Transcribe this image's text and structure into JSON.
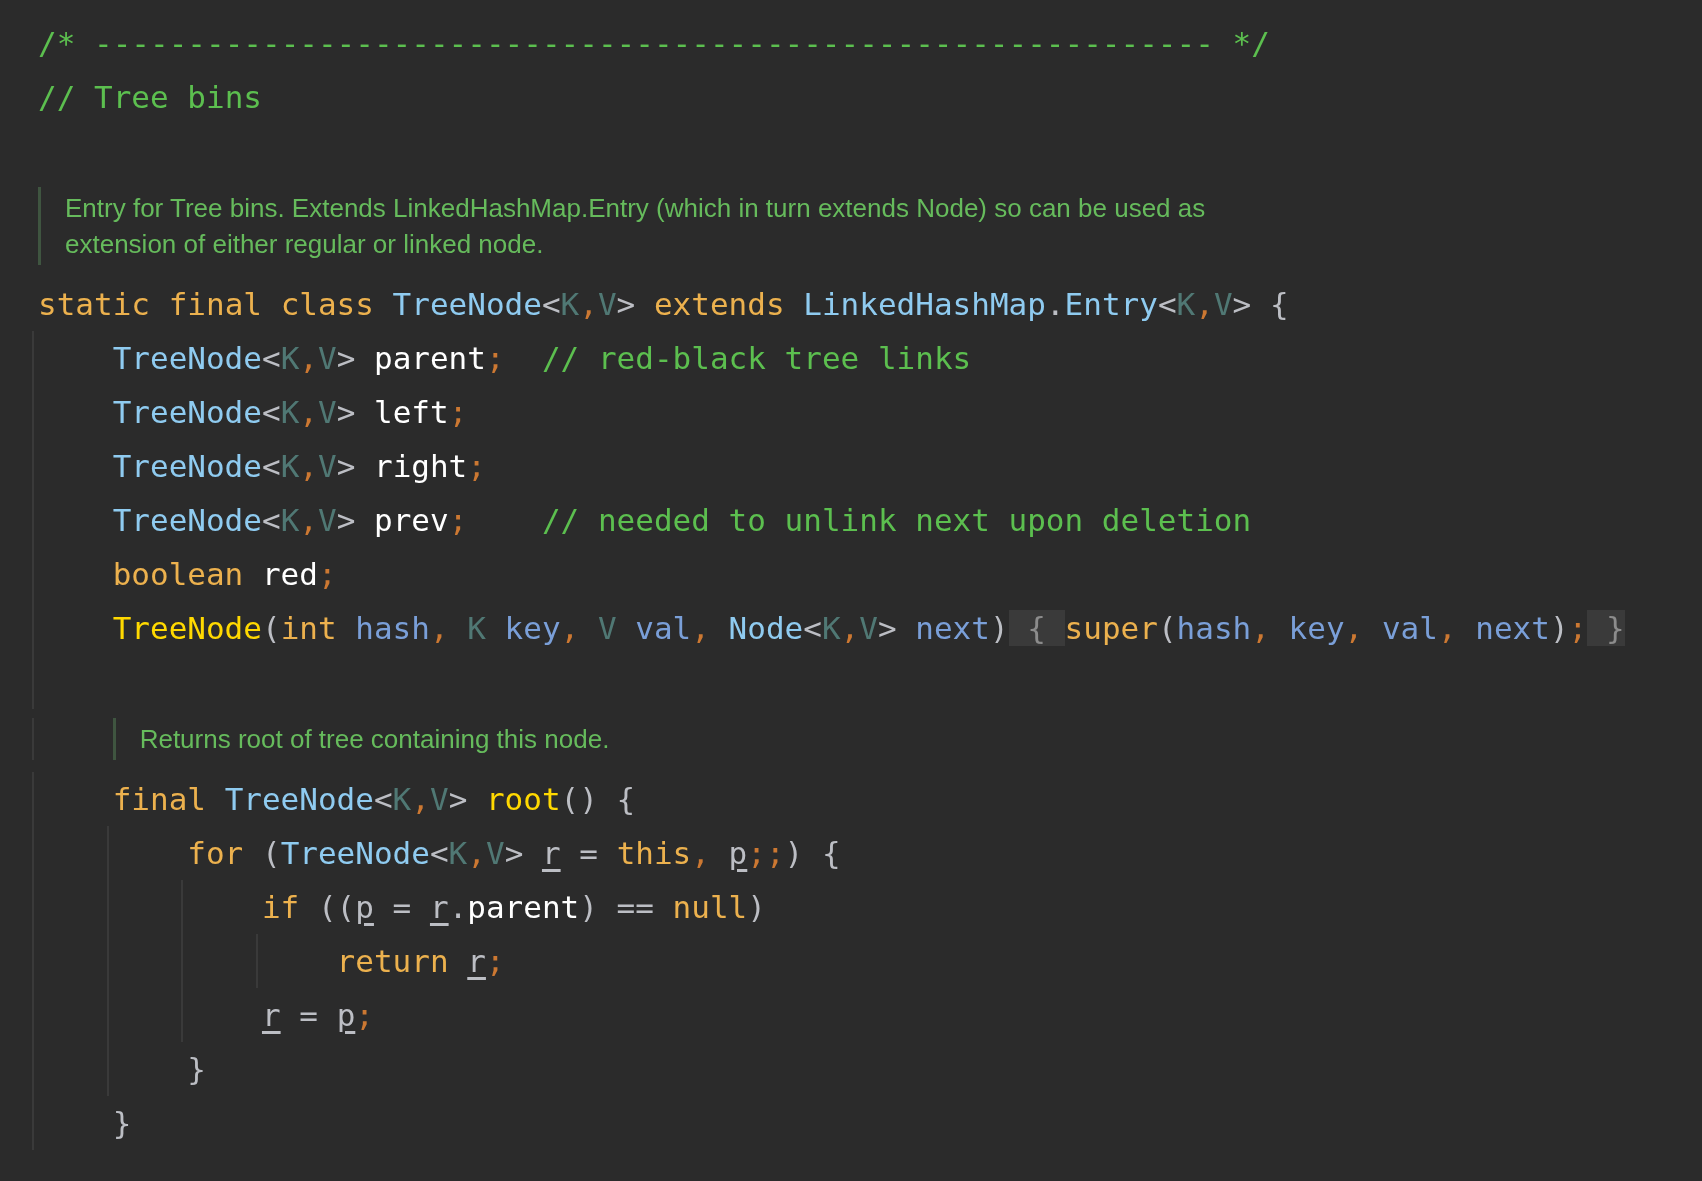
{
  "lines": [
    {
      "kind": "code",
      "tokens": [
        {
          "kind": "comment",
          "text": "/* ------------------------------------------------------------ */"
        }
      ]
    },
    {
      "kind": "code",
      "tokens": [
        {
          "kind": "comment",
          "text": "// Tree bins"
        }
      ]
    },
    {
      "kind": "blank"
    },
    {
      "kind": "doc",
      "text": "Entry for Tree bins. Extends LinkedHashMap.Entry (which in turn extends Node) so can be used as extension of either regular or linked node."
    },
    {
      "kind": "code",
      "tokens": [
        {
          "kind": "keyword",
          "text": "static final class "
        },
        {
          "kind": "type",
          "text": "TreeNode"
        },
        {
          "kind": "op",
          "text": "<"
        },
        {
          "kind": "typeparam",
          "text": "K"
        },
        {
          "kind": "punct",
          "text": ","
        },
        {
          "kind": "typeparam",
          "text": "V"
        },
        {
          "kind": "op",
          "text": "> "
        },
        {
          "kind": "keyword",
          "text": "extends "
        },
        {
          "kind": "type",
          "text": "LinkedHashMap"
        },
        {
          "kind": "op",
          "text": "."
        },
        {
          "kind": "type",
          "text": "Entry"
        },
        {
          "kind": "op",
          "text": "<"
        },
        {
          "kind": "typeparam",
          "text": "K"
        },
        {
          "kind": "punct",
          "text": ","
        },
        {
          "kind": "typeparam",
          "text": "V"
        },
        {
          "kind": "op",
          "text": "> {"
        }
      ],
      "children": [
        {
          "kind": "code",
          "tokens": [
            {
              "kind": "type",
              "text": "TreeNode"
            },
            {
              "kind": "op",
              "text": "<"
            },
            {
              "kind": "typeparam",
              "text": "K"
            },
            {
              "kind": "punct",
              "text": ","
            },
            {
              "kind": "typeparam",
              "text": "V"
            },
            {
              "kind": "op",
              "text": "> "
            },
            {
              "kind": "field",
              "text": "parent"
            },
            {
              "kind": "punct",
              "text": ";  "
            },
            {
              "kind": "comment",
              "text": "// red-black tree links"
            }
          ]
        },
        {
          "kind": "code",
          "tokens": [
            {
              "kind": "type",
              "text": "TreeNode"
            },
            {
              "kind": "op",
              "text": "<"
            },
            {
              "kind": "typeparam",
              "text": "K"
            },
            {
              "kind": "punct",
              "text": ","
            },
            {
              "kind": "typeparam",
              "text": "V"
            },
            {
              "kind": "op",
              "text": "> "
            },
            {
              "kind": "field",
              "text": "left"
            },
            {
              "kind": "punct",
              "text": ";"
            }
          ]
        },
        {
          "kind": "code",
          "tokens": [
            {
              "kind": "type",
              "text": "TreeNode"
            },
            {
              "kind": "op",
              "text": "<"
            },
            {
              "kind": "typeparam",
              "text": "K"
            },
            {
              "kind": "punct",
              "text": ","
            },
            {
              "kind": "typeparam",
              "text": "V"
            },
            {
              "kind": "op",
              "text": "> "
            },
            {
              "kind": "field",
              "text": "right"
            },
            {
              "kind": "punct",
              "text": ";"
            }
          ]
        },
        {
          "kind": "code",
          "tokens": [
            {
              "kind": "type",
              "text": "TreeNode"
            },
            {
              "kind": "op",
              "text": "<"
            },
            {
              "kind": "typeparam",
              "text": "K"
            },
            {
              "kind": "punct",
              "text": ","
            },
            {
              "kind": "typeparam",
              "text": "V"
            },
            {
              "kind": "op",
              "text": "> "
            },
            {
              "kind": "field",
              "text": "prev"
            },
            {
              "kind": "punct",
              "text": ";    "
            },
            {
              "kind": "comment",
              "text": "// needed to unlink next upon deletion"
            }
          ]
        },
        {
          "kind": "code",
          "tokens": [
            {
              "kind": "keyword",
              "text": "boolean "
            },
            {
              "kind": "field",
              "text": "red"
            },
            {
              "kind": "punct",
              "text": ";"
            }
          ]
        },
        {
          "kind": "code",
          "tokens": [
            {
              "kind": "method",
              "text": "TreeNode"
            },
            {
              "kind": "op",
              "text": "("
            },
            {
              "kind": "keyword",
              "text": "int "
            },
            {
              "kind": "param",
              "text": "hash"
            },
            {
              "kind": "punct",
              "text": ", "
            },
            {
              "kind": "typeparam",
              "text": "K "
            },
            {
              "kind": "param",
              "text": "key"
            },
            {
              "kind": "punct",
              "text": ", "
            },
            {
              "kind": "typeparam",
              "text": "V "
            },
            {
              "kind": "param",
              "text": "val"
            },
            {
              "kind": "punct",
              "text": ", "
            },
            {
              "kind": "type",
              "text": "Node"
            },
            {
              "kind": "op",
              "text": "<"
            },
            {
              "kind": "typeparam",
              "text": "K"
            },
            {
              "kind": "punct",
              "text": ","
            },
            {
              "kind": "typeparam",
              "text": "V"
            },
            {
              "kind": "op",
              "text": "> "
            },
            {
              "kind": "param",
              "text": "next"
            },
            {
              "kind": "op",
              "text": ")"
            },
            {
              "kind": "fold",
              "text": " { "
            },
            {
              "kind": "keyword",
              "text": "super"
            },
            {
              "kind": "op",
              "text": "("
            },
            {
              "kind": "param",
              "text": "hash"
            },
            {
              "kind": "punct",
              "text": ", "
            },
            {
              "kind": "param",
              "text": "key"
            },
            {
              "kind": "punct",
              "text": ", "
            },
            {
              "kind": "param",
              "text": "val"
            },
            {
              "kind": "punct",
              "text": ", "
            },
            {
              "kind": "param",
              "text": "next"
            },
            {
              "kind": "op",
              "text": ")"
            },
            {
              "kind": "punct",
              "text": ";"
            },
            {
              "kind": "fold",
              "text": " }"
            }
          ]
        },
        {
          "kind": "blank"
        },
        {
          "kind": "doc",
          "text": "Returns root of tree containing this node."
        },
        {
          "kind": "code",
          "tokens": [
            {
              "kind": "keyword",
              "text": "final "
            },
            {
              "kind": "type",
              "text": "TreeNode"
            },
            {
              "kind": "op",
              "text": "<"
            },
            {
              "kind": "typeparam",
              "text": "K"
            },
            {
              "kind": "punct",
              "text": ","
            },
            {
              "kind": "typeparam",
              "text": "V"
            },
            {
              "kind": "op",
              "text": "> "
            },
            {
              "kind": "method",
              "text": "root"
            },
            {
              "kind": "op",
              "text": "() {"
            }
          ],
          "children": [
            {
              "kind": "code",
              "tokens": [
                {
                  "kind": "keyword",
                  "text": "for "
                },
                {
                  "kind": "op",
                  "text": "("
                },
                {
                  "kind": "type",
                  "text": "TreeNode"
                },
                {
                  "kind": "op",
                  "text": "<"
                },
                {
                  "kind": "typeparam",
                  "text": "K"
                },
                {
                  "kind": "punct",
                  "text": ","
                },
                {
                  "kind": "typeparam",
                  "text": "V"
                },
                {
                  "kind": "op",
                  "text": "> "
                },
                {
                  "kind": "local",
                  "text": "r"
                },
                {
                  "kind": "op",
                  "text": " = "
                },
                {
                  "kind": "keyword",
                  "text": "this"
                },
                {
                  "kind": "punct",
                  "text": ", "
                },
                {
                  "kind": "local",
                  "text": "p"
                },
                {
                  "kind": "punct",
                  "text": ";;"
                },
                {
                  "kind": "op",
                  "text": ") {"
                }
              ],
              "children": [
                {
                  "kind": "code",
                  "tokens": [
                    {
                      "kind": "keyword",
                      "text": "if "
                    },
                    {
                      "kind": "op",
                      "text": "(("
                    },
                    {
                      "kind": "local",
                      "text": "p"
                    },
                    {
                      "kind": "op",
                      "text": " = "
                    },
                    {
                      "kind": "local",
                      "text": "r"
                    },
                    {
                      "kind": "op",
                      "text": "."
                    },
                    {
                      "kind": "field",
                      "text": "parent"
                    },
                    {
                      "kind": "op",
                      "text": ") == "
                    },
                    {
                      "kind": "keyword",
                      "text": "null"
                    },
                    {
                      "kind": "op",
                      "text": ")"
                    }
                  ],
                  "children": [
                    {
                      "kind": "code",
                      "tokens": [
                        {
                          "kind": "keyword",
                          "text": "return "
                        },
                        {
                          "kind": "local",
                          "text": "r"
                        },
                        {
                          "kind": "punct",
                          "text": ";"
                        }
                      ]
                    }
                  ]
                },
                {
                  "kind": "code",
                  "tokens": [
                    {
                      "kind": "local",
                      "text": "r"
                    },
                    {
                      "kind": "op",
                      "text": " = "
                    },
                    {
                      "kind": "local",
                      "text": "p"
                    },
                    {
                      "kind": "punct",
                      "text": ";"
                    }
                  ]
                }
              ]
            },
            {
              "kind": "code",
              "tokens": [
                {
                  "kind": "op",
                  "text": "}"
                }
              ]
            }
          ]
        },
        {
          "kind": "code",
          "tokens": [
            {
              "kind": "op",
              "text": "}"
            }
          ]
        }
      ]
    }
  ]
}
